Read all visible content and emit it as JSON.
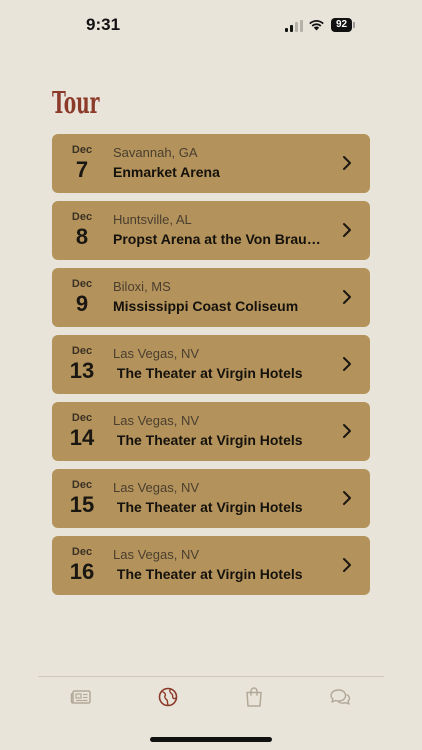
{
  "status_bar": {
    "time": "9:31",
    "battery": "92"
  },
  "page": {
    "title": "Tour"
  },
  "colors": {
    "background": "#e9e4da",
    "card": "#b3935b",
    "title": "#8b3a2a",
    "tab_active": "#8b3a2a",
    "tab_inactive": "#b2a898"
  },
  "tour": [
    {
      "month": "Dec",
      "day": "7",
      "location": "Savannah, GA",
      "venue": "Enmarket Arena"
    },
    {
      "month": "Dec",
      "day": "8",
      "location": "Huntsville, AL",
      "venue": "Propst Arena at the Von Braun Center"
    },
    {
      "month": "Dec",
      "day": "9",
      "location": "Biloxi, MS",
      "venue": "Mississippi Coast Coliseum"
    },
    {
      "month": "Dec",
      "day": "13",
      "location": "Las Vegas, NV",
      "venue": " The Theater at Virgin Hotels"
    },
    {
      "month": "Dec",
      "day": "14",
      "location": "Las Vegas, NV",
      "venue": " The Theater at Virgin Hotels"
    },
    {
      "month": "Dec",
      "day": "15",
      "location": "Las Vegas, NV",
      "venue": " The Theater at Virgin Hotels"
    },
    {
      "month": "Dec",
      "day": "16",
      "location": "Las Vegas, NV",
      "venue": " The Theater at Virgin Hotels"
    }
  ],
  "tab_bar": {
    "items": [
      {
        "icon": "news-icon",
        "active": false
      },
      {
        "icon": "globe-icon",
        "active": true
      },
      {
        "icon": "shopping-bag-icon",
        "active": false
      },
      {
        "icon": "chat-bubbles-icon",
        "active": false
      }
    ]
  }
}
